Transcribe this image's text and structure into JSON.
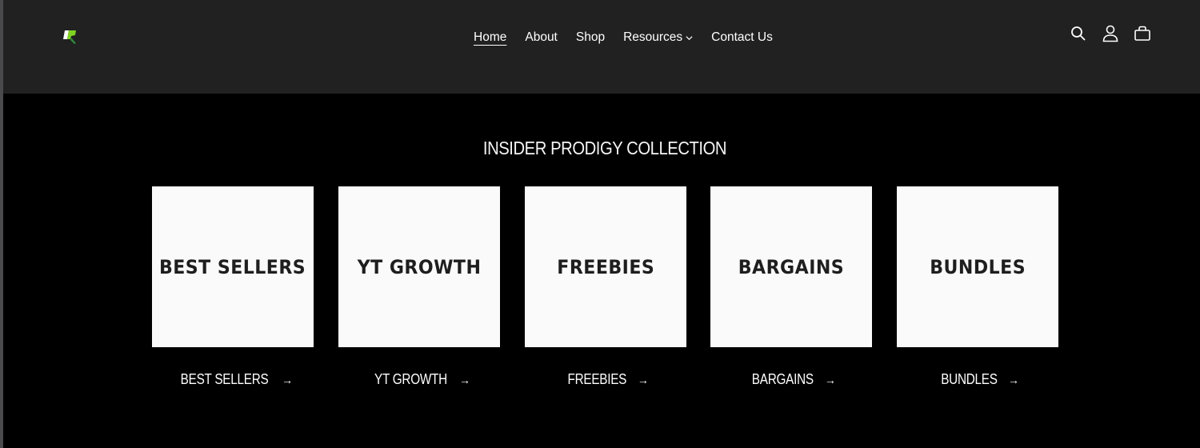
{
  "header": {
    "logo_name": "Insider Prodigy logo",
    "nav": [
      {
        "label": "Home",
        "active": true
      },
      {
        "label": "About"
      },
      {
        "label": "Shop"
      },
      {
        "label": "Resources",
        "has_dropdown": true
      },
      {
        "label": "Contact Us"
      }
    ],
    "icons": [
      "search-icon",
      "account-icon",
      "cart-icon"
    ]
  },
  "main": {
    "title": "INSIDER PRODIGY COLLECTION",
    "collections": [
      {
        "image_text": "BEST SELLERS",
        "label": "BEST SELLERS"
      },
      {
        "image_text": "YT GROWTH",
        "label": "YT GROWTH"
      },
      {
        "image_text": "FREEBIES",
        "label": "FREEBIES"
      },
      {
        "image_text": "BARGAINS",
        "label": "BARGAINS"
      },
      {
        "image_text": "BUNDLES",
        "label": "BUNDLES"
      }
    ],
    "arrow": "→"
  },
  "colors": {
    "header_bg": "#212121",
    "page_bg": "#000000",
    "logo_green": "#7ed321"
  }
}
